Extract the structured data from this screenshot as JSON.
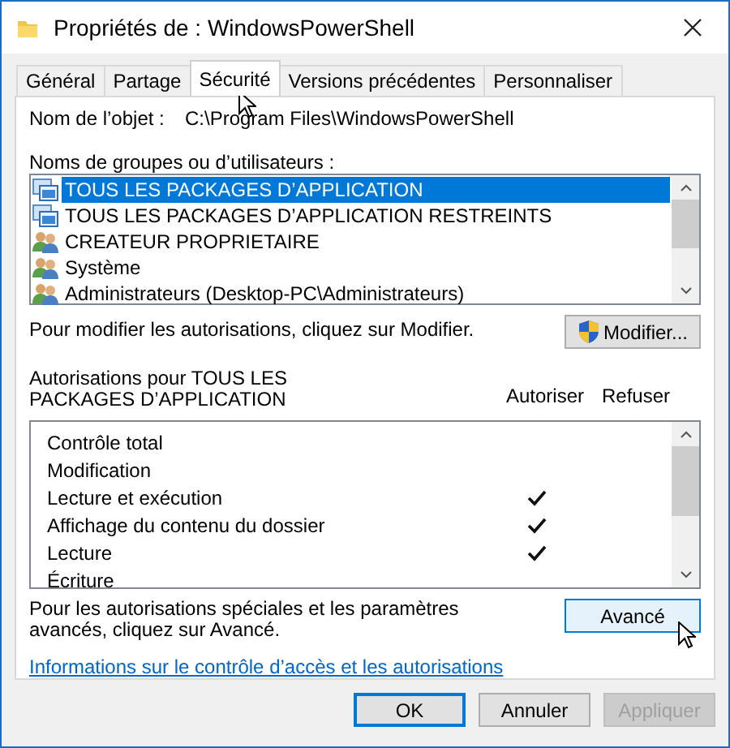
{
  "window": {
    "title": "Propriétés de : WindowsPowerShell"
  },
  "tabs": [
    {
      "label": "Général",
      "selected": false
    },
    {
      "label": "Partage",
      "selected": false
    },
    {
      "label": "Sécurité",
      "selected": true
    },
    {
      "label": "Versions précédentes",
      "selected": false
    },
    {
      "label": "Personnaliser",
      "selected": false
    }
  ],
  "object": {
    "label": "Nom de l’objet :",
    "value": "C:\\Program Files\\WindowsPowerShell"
  },
  "groups": {
    "label": "Noms de groupes ou d’utilisateurs :",
    "items": [
      {
        "name": "TOUS LES PACKAGES D’APPLICATION",
        "kind": "package",
        "selected": true
      },
      {
        "name": "TOUS LES PACKAGES D’APPLICATION RESTREINTS",
        "kind": "package",
        "selected": false
      },
      {
        "name": "CREATEUR PROPRIETAIRE",
        "kind": "users",
        "selected": false
      },
      {
        "name": "Système",
        "kind": "users",
        "selected": false
      },
      {
        "name": "Administrateurs (Desktop-PC\\Administrateurs)",
        "kind": "users",
        "selected": false
      }
    ]
  },
  "modify": {
    "text": "Pour modifier les autorisations, cliquez sur Modifier.",
    "button": "Modifier..."
  },
  "permissions": {
    "label": "Autorisations pour TOUS LES PACKAGES D’APPLICATION",
    "columns": [
      "Autoriser",
      "Refuser"
    ],
    "rows": [
      {
        "name": "Contrôle total",
        "allow": false,
        "deny": false
      },
      {
        "name": "Modification",
        "allow": false,
        "deny": false
      },
      {
        "name": "Lecture et exécution",
        "allow": true,
        "deny": false
      },
      {
        "name": "Affichage du contenu du dossier",
        "allow": true,
        "deny": false
      },
      {
        "name": "Lecture",
        "allow": true,
        "deny": false
      },
      {
        "name": "Écriture",
        "allow": false,
        "deny": false
      }
    ]
  },
  "advanced": {
    "text": "Pour les autorisations spéciales et les paramètres avancés, cliquez sur Avancé.",
    "button": "Avancé"
  },
  "link": "Informations sur le contrôle d’accès et les autorisations",
  "buttons": [
    {
      "label": "OK",
      "default": true,
      "disabled": false
    },
    {
      "label": "Annuler",
      "default": false,
      "disabled": false
    },
    {
      "label": "Appliquer",
      "default": false,
      "disabled": true
    }
  ]
}
